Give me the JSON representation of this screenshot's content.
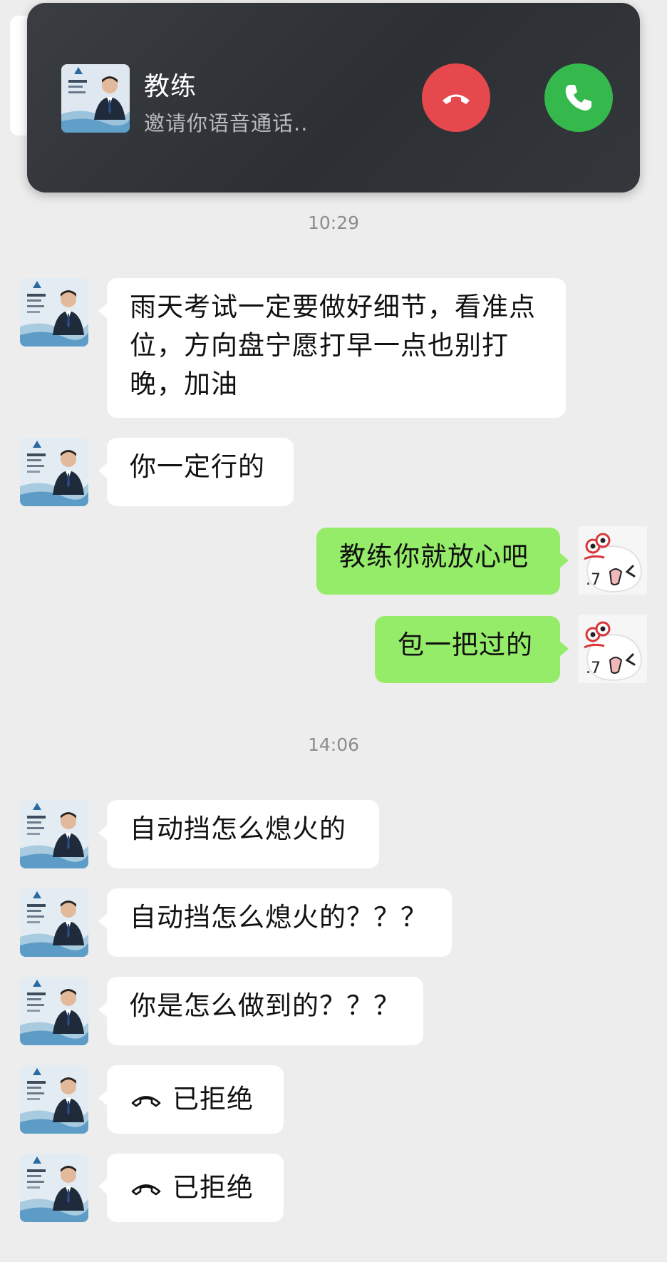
{
  "call": {
    "name": "教练",
    "subtitle": "邀请你语音通话..",
    "decline_icon": "hang-up-icon",
    "accept_icon": "phone-icon"
  },
  "timestamps": [
    "10:29",
    "14:06"
  ],
  "messages": [
    {
      "side": "left",
      "text": "雨天考试一定要做好细节，看准点位，方向盘宁愿打早一点也别打晚，加油"
    },
    {
      "side": "left",
      "text": "你一定行的"
    },
    {
      "side": "right",
      "text": "教练你就放心吧"
    },
    {
      "side": "right",
      "text": "包一把过的"
    },
    {
      "side": "left",
      "text": "自动挡怎么熄火的"
    },
    {
      "side": "left",
      "text": "自动挡怎么熄火的？？？"
    },
    {
      "side": "left",
      "text": "你是怎么做到的？？？"
    },
    {
      "side": "left",
      "text": "已拒绝",
      "icon": "hang-up-icon"
    },
    {
      "side": "left",
      "text": "已拒绝",
      "icon": "hang-up-icon"
    }
  ],
  "colors": {
    "background": "#ededed",
    "bubble_left": "#ffffff",
    "bubble_right": "#95ec69",
    "decline": "#e5484d",
    "accept": "#35b94d"
  }
}
